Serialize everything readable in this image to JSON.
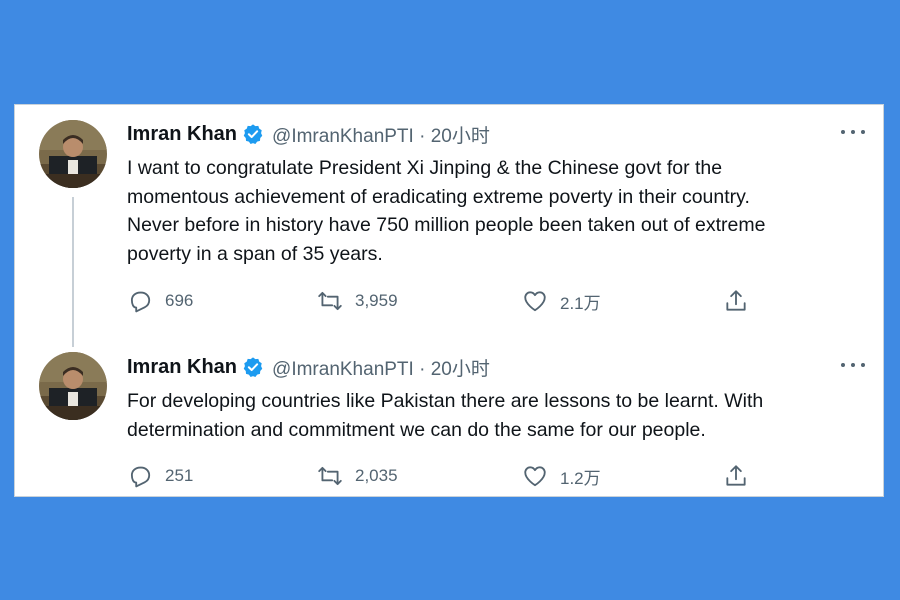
{
  "colors": {
    "background": "#3f8ae3",
    "verified": "#1d9bf0",
    "text": "#0f1419",
    "muted": "#536471"
  },
  "tweets": [
    {
      "name": "Imran Khan",
      "handle": "@ImranKhanPTI · 20小时",
      "text": "I want to congratulate President Xi Jinping & the Chinese govt for the\nmomentous achievement of eradicating extreme poverty in their country.\nNever before in history have 750 million people been taken out of extreme\npoverty in a span of 35 years.",
      "replies": "696",
      "retweets": "3,959",
      "likes": "2.1万",
      "icons": [
        "reply-icon",
        "retweet-icon",
        "like-icon",
        "share-icon",
        "verified-badge-icon",
        "more-icon"
      ]
    },
    {
      "name": "Imran Khan",
      "handle": "@ImranKhanPTI · 20小时",
      "text": "For developing countries like Pakistan there are lessons to be learnt. With\ndetermination and commitment we can do the same for our people.",
      "replies": "251",
      "retweets": "2,035",
      "likes": "1.2万",
      "icons": [
        "reply-icon",
        "retweet-icon",
        "like-icon",
        "share-icon",
        "verified-badge-icon",
        "more-icon"
      ]
    }
  ]
}
